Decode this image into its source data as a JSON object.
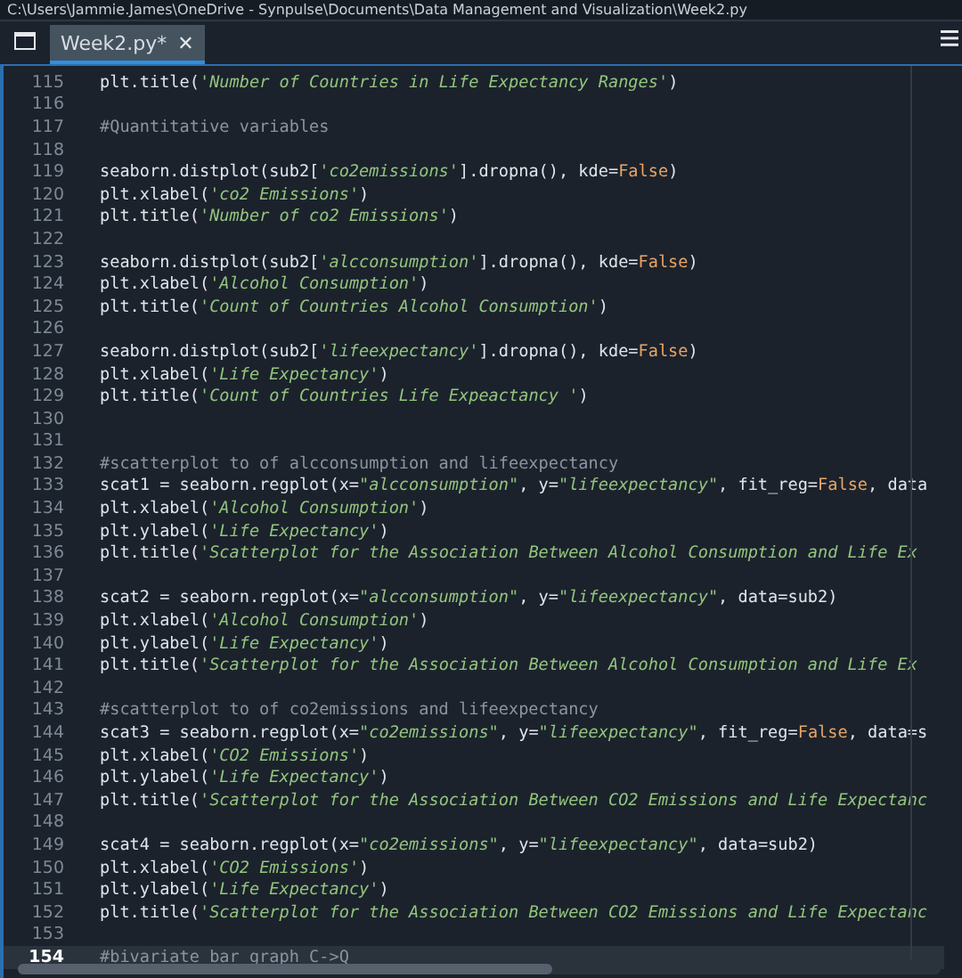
{
  "window": {
    "title": "C:\\Users\\Jammie.James\\OneDrive - Synpulse\\Documents\\Data Management and Visualization\\Week2.py"
  },
  "tabs": [
    {
      "label": "Week2.py*",
      "selected": true,
      "close": "✕"
    }
  ],
  "editor": {
    "lines": [
      {
        "number": "115",
        "current": false,
        "segments": [
          {
            "kind": "text",
            "text": "plt.title("
          },
          {
            "kind": "string",
            "text": "'Number of Countries in Life Expectancy Ranges'"
          },
          {
            "kind": "text",
            "text": ")"
          }
        ]
      },
      {
        "number": "116",
        "current": false
      },
      {
        "number": "117",
        "current": false,
        "segments": [
          {
            "kind": "comment",
            "text": "#Quantitative variables"
          }
        ]
      },
      {
        "number": "118",
        "current": false
      },
      {
        "number": "119",
        "current": false,
        "segments": [
          {
            "kind": "text",
            "text": "seaborn.distplot(sub2["
          },
          {
            "kind": "string",
            "text": "'co2emissions'"
          },
          {
            "kind": "text",
            "text": "].dropna(), kde="
          },
          {
            "kind": "keyword",
            "text": "False"
          },
          {
            "kind": "text",
            "text": ")"
          }
        ]
      },
      {
        "number": "120",
        "current": false,
        "segments": [
          {
            "kind": "text",
            "text": "plt.xlabel("
          },
          {
            "kind": "string",
            "text": "'co2 Emissions'"
          },
          {
            "kind": "text",
            "text": ")"
          }
        ]
      },
      {
        "number": "121",
        "current": false,
        "segments": [
          {
            "kind": "text",
            "text": "plt.title("
          },
          {
            "kind": "string",
            "text": "'Number of co2 Emissions'"
          },
          {
            "kind": "text",
            "text": ")"
          }
        ]
      },
      {
        "number": "122",
        "current": false
      },
      {
        "number": "123",
        "current": false,
        "segments": [
          {
            "kind": "text",
            "text": "seaborn.distplot(sub2["
          },
          {
            "kind": "string",
            "text": "'alcconsumption'"
          },
          {
            "kind": "text",
            "text": "].dropna(), kde="
          },
          {
            "kind": "keyword",
            "text": "False"
          },
          {
            "kind": "text",
            "text": ")"
          }
        ]
      },
      {
        "number": "124",
        "current": false,
        "segments": [
          {
            "kind": "text",
            "text": "plt.xlabel("
          },
          {
            "kind": "string",
            "text": "'Alcohol Consumption'"
          },
          {
            "kind": "text",
            "text": ")"
          }
        ]
      },
      {
        "number": "125",
        "current": false,
        "segments": [
          {
            "kind": "text",
            "text": "plt.title("
          },
          {
            "kind": "string",
            "text": "'Count of Countries Alcohol Consumption'"
          },
          {
            "kind": "text",
            "text": ")"
          }
        ]
      },
      {
        "number": "126",
        "current": false
      },
      {
        "number": "127",
        "current": false,
        "segments": [
          {
            "kind": "text",
            "text": "seaborn.distplot(sub2["
          },
          {
            "kind": "string",
            "text": "'lifeexpectancy'"
          },
          {
            "kind": "text",
            "text": "].dropna(), kde="
          },
          {
            "kind": "keyword",
            "text": "False"
          },
          {
            "kind": "text",
            "text": ")"
          }
        ]
      },
      {
        "number": "128",
        "current": false,
        "segments": [
          {
            "kind": "text",
            "text": "plt.xlabel("
          },
          {
            "kind": "string",
            "text": "'Life Expectancy'"
          },
          {
            "kind": "text",
            "text": ")"
          }
        ]
      },
      {
        "number": "129",
        "current": false,
        "segments": [
          {
            "kind": "text",
            "text": "plt.title("
          },
          {
            "kind": "string",
            "text": "'Count of Countries Life Expeactancy '"
          },
          {
            "kind": "text",
            "text": ")"
          }
        ]
      },
      {
        "number": "130",
        "current": false
      },
      {
        "number": "131",
        "current": false
      },
      {
        "number": "132",
        "current": false,
        "segments": [
          {
            "kind": "comment",
            "text": "#scatterplot to of alcconsumption and lifeexpectancy"
          }
        ]
      },
      {
        "number": "133",
        "current": false,
        "segments": [
          {
            "kind": "text",
            "text": "scat1 = seaborn.regplot(x="
          },
          {
            "kind": "string",
            "text": "\"alcconsumption\""
          },
          {
            "kind": "text",
            "text": ", y="
          },
          {
            "kind": "string",
            "text": "\"lifeexpectancy\""
          },
          {
            "kind": "text",
            "text": ", fit_reg="
          },
          {
            "kind": "keyword",
            "text": "False"
          },
          {
            "kind": "text",
            "text": ", data"
          }
        ]
      },
      {
        "number": "134",
        "current": false,
        "segments": [
          {
            "kind": "text",
            "text": "plt.xlabel("
          },
          {
            "kind": "string",
            "text": "'Alcohol Consumption'"
          },
          {
            "kind": "text",
            "text": ")"
          }
        ]
      },
      {
        "number": "135",
        "current": false,
        "segments": [
          {
            "kind": "text",
            "text": "plt.ylabel("
          },
          {
            "kind": "string",
            "text": "'Life Expectancy'"
          },
          {
            "kind": "text",
            "text": ")"
          }
        ]
      },
      {
        "number": "136",
        "current": false,
        "segments": [
          {
            "kind": "text",
            "text": "plt.title("
          },
          {
            "kind": "string",
            "text": "'Scatterplot for the Association Between Alcohol Consumption and Life Ex"
          }
        ]
      },
      {
        "number": "137",
        "current": false
      },
      {
        "number": "138",
        "current": false,
        "segments": [
          {
            "kind": "text",
            "text": "scat2 = seaborn.regplot(x="
          },
          {
            "kind": "string",
            "text": "\"alcconsumption\""
          },
          {
            "kind": "text",
            "text": ", y="
          },
          {
            "kind": "string",
            "text": "\"lifeexpectancy\""
          },
          {
            "kind": "text",
            "text": ", data=sub2)"
          }
        ]
      },
      {
        "number": "139",
        "current": false,
        "segments": [
          {
            "kind": "text",
            "text": "plt.xlabel("
          },
          {
            "kind": "string",
            "text": "'Alcohol Consumption'"
          },
          {
            "kind": "text",
            "text": ")"
          }
        ]
      },
      {
        "number": "140",
        "current": false,
        "segments": [
          {
            "kind": "text",
            "text": "plt.ylabel("
          },
          {
            "kind": "string",
            "text": "'Life Expectancy'"
          },
          {
            "kind": "text",
            "text": ")"
          }
        ]
      },
      {
        "number": "141",
        "current": false,
        "segments": [
          {
            "kind": "text",
            "text": "plt.title("
          },
          {
            "kind": "string",
            "text": "'Scatterplot for the Association Between Alcohol Consumption and Life Ex"
          }
        ]
      },
      {
        "number": "142",
        "current": false
      },
      {
        "number": "143",
        "current": false,
        "segments": [
          {
            "kind": "comment",
            "text": "#scatterplot to of co2emissions and lifeexpectancy"
          }
        ]
      },
      {
        "number": "144",
        "current": false,
        "segments": [
          {
            "kind": "text",
            "text": "scat3 = seaborn.regplot(x="
          },
          {
            "kind": "string",
            "text": "\"co2emissions\""
          },
          {
            "kind": "text",
            "text": ", y="
          },
          {
            "kind": "string",
            "text": "\"lifeexpectancy\""
          },
          {
            "kind": "text",
            "text": ", fit_reg="
          },
          {
            "kind": "keyword",
            "text": "False"
          },
          {
            "kind": "text",
            "text": ", data=s"
          }
        ]
      },
      {
        "number": "145",
        "current": false,
        "segments": [
          {
            "kind": "text",
            "text": "plt.xlabel("
          },
          {
            "kind": "string",
            "text": "'CO2 Emissions'"
          },
          {
            "kind": "text",
            "text": ")"
          }
        ]
      },
      {
        "number": "146",
        "current": false,
        "segments": [
          {
            "kind": "text",
            "text": "plt.ylabel("
          },
          {
            "kind": "string",
            "text": "'Life Expectancy'"
          },
          {
            "kind": "text",
            "text": ")"
          }
        ]
      },
      {
        "number": "147",
        "current": false,
        "segments": [
          {
            "kind": "text",
            "text": "plt.title("
          },
          {
            "kind": "string",
            "text": "'Scatterplot for the Association Between CO2 Emissions and Life Expectanc"
          }
        ]
      },
      {
        "number": "148",
        "current": false
      },
      {
        "number": "149",
        "current": false,
        "segments": [
          {
            "kind": "text",
            "text": "scat4 = seaborn.regplot(x="
          },
          {
            "kind": "string",
            "text": "\"co2emissions\""
          },
          {
            "kind": "text",
            "text": ", y="
          },
          {
            "kind": "string",
            "text": "\"lifeexpectancy\""
          },
          {
            "kind": "text",
            "text": ", data=sub2)"
          }
        ]
      },
      {
        "number": "150",
        "current": false,
        "segments": [
          {
            "kind": "text",
            "text": "plt.xlabel("
          },
          {
            "kind": "string",
            "text": "'CO2 Emissions'"
          },
          {
            "kind": "text",
            "text": ")"
          }
        ]
      },
      {
        "number": "151",
        "current": false,
        "segments": [
          {
            "kind": "text",
            "text": "plt.ylabel("
          },
          {
            "kind": "string",
            "text": "'Life Expectancy'"
          },
          {
            "kind": "text",
            "text": ")"
          }
        ]
      },
      {
        "number": "152",
        "current": false,
        "segments": [
          {
            "kind": "text",
            "text": "plt.title("
          },
          {
            "kind": "string",
            "text": "'Scatterplot for the Association Between CO2 Emissions and Life Expectanc"
          }
        ]
      },
      {
        "number": "153",
        "current": false
      },
      {
        "number": "154",
        "current": true,
        "segments": [
          {
            "kind": "comment",
            "text": "#bivariate bar graph C->Q"
          }
        ]
      }
    ]
  }
}
